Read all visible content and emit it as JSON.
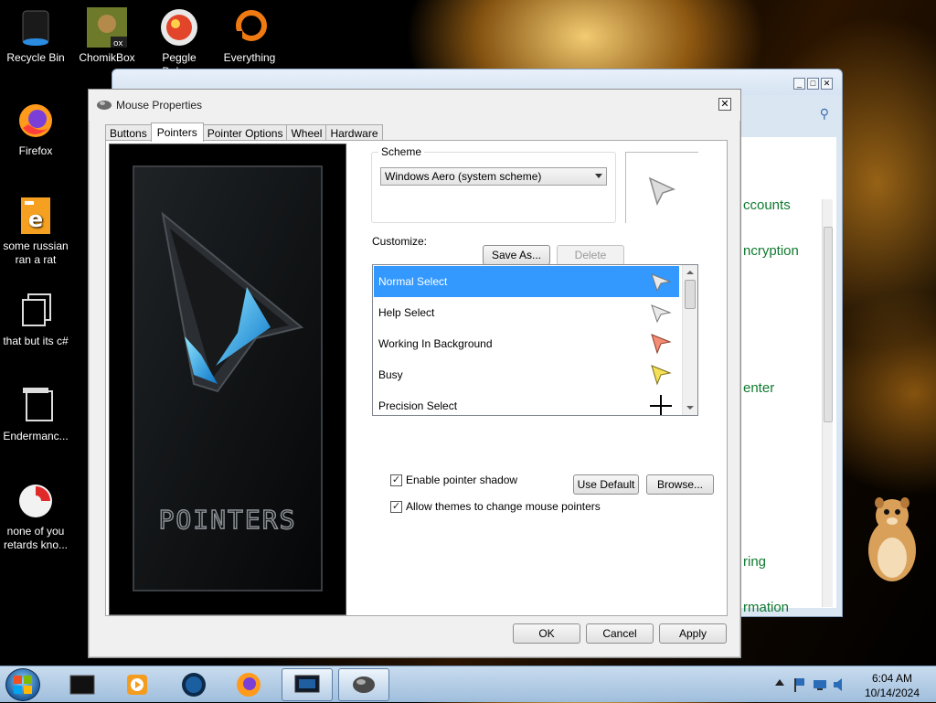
{
  "desktop": {
    "icons": [
      {
        "label": "Recycle Bin",
        "icon": "recycle-bin-icon"
      },
      {
        "label": "ChomikBox",
        "icon": "chomikbox-icon"
      },
      {
        "label": "Peggle Deluxe",
        "icon": "peggle-icon"
      },
      {
        "label": "Everything",
        "icon": "everything-search-icon"
      },
      {
        "label": "Firefox",
        "icon": "firefox-icon"
      },
      {
        "label": "some russian ran a rat",
        "icon": "exe-file-icon"
      },
      {
        "label": "that but its c#",
        "icon": "shortcut-file-icon"
      },
      {
        "label": "Endermanc...",
        "icon": "shortcut-file-icon"
      },
      {
        "label": "none of you retards kno...",
        "icon": "app-icon"
      }
    ]
  },
  "background_window": {
    "links": [
      "ccounts",
      "ncryption",
      "enter",
      "ring",
      "rmation"
    ]
  },
  "dialog": {
    "title": "Mouse Properties",
    "close_glyph": "✕",
    "tabs": [
      "Buttons",
      "Pointers",
      "Pointer Options",
      "Wheel",
      "Hardware"
    ],
    "active_tab": "Pointers",
    "preview_text": "POINTERS",
    "scheme": {
      "label": "Scheme",
      "selected": "Windows Aero (system scheme)",
      "save_as": "Save As...",
      "delete": "Delete"
    },
    "customize_label": "Customize:",
    "cursor_list": [
      {
        "label": "Normal Select",
        "icon": "normal-select-cursor-icon",
        "selected": true
      },
      {
        "label": "Help Select",
        "icon": "help-select-cursor-icon",
        "selected": false
      },
      {
        "label": "Working In Background",
        "icon": "working-background-cursor-icon",
        "selected": false
      },
      {
        "label": "Busy",
        "icon": "busy-cursor-icon",
        "selected": false
      },
      {
        "label": "Precision Select",
        "icon": "crosshair-cursor-icon",
        "selected": false
      }
    ],
    "enable_shadow": {
      "label": "Enable pointer shadow",
      "checked": true,
      "mark": "✓"
    },
    "allow_themes": {
      "label": "Allow themes to change mouse pointers",
      "checked": true,
      "mark": "✓"
    },
    "use_default": "Use Default",
    "browse": "Browse...",
    "ok": "OK",
    "cancel": "Cancel",
    "apply": "Apply"
  },
  "taskbar": {
    "time": "6:04 AM",
    "date": "10/14/2024"
  }
}
